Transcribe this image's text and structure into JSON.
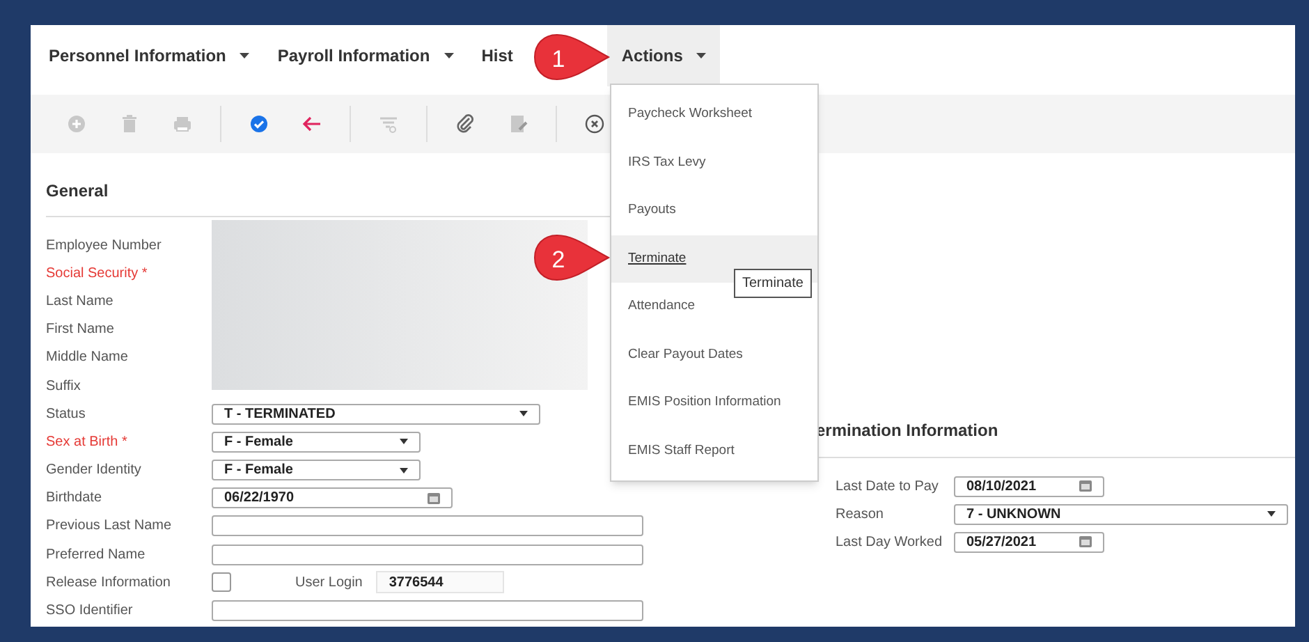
{
  "menus": [
    {
      "label": "Personnel Information",
      "caret": true,
      "selected": false
    },
    {
      "label": "Payroll Information",
      "caret": true,
      "selected": false
    },
    {
      "label": "Hist",
      "caret": false,
      "selected": false
    },
    {
      "label": "Actions",
      "caret": true,
      "selected": true
    }
  ],
  "toolbar": [
    [
      {
        "kind": "add",
        "disabled": true
      },
      {
        "kind": "delete",
        "disabled": true
      },
      {
        "kind": "print",
        "disabled": true
      }
    ],
    [
      {
        "kind": "save",
        "disabled": false
      },
      {
        "kind": "back",
        "disabled": false
      }
    ],
    [
      {
        "kind": "filter",
        "disabled": true
      }
    ],
    [
      {
        "kind": "attach",
        "disabled": false
      },
      {
        "kind": "edit",
        "disabled": true
      }
    ],
    [
      {
        "kind": "cancel",
        "disabled": false
      }
    ]
  ],
  "general": {
    "title": "General",
    "fields": [
      {
        "label": "Employee Number",
        "required": false,
        "kind": "redacted"
      },
      {
        "label": "Social Security *",
        "required": true,
        "kind": "redacted"
      },
      {
        "label": "Last Name",
        "required": false,
        "kind": "redacted"
      },
      {
        "label": "First Name",
        "required": false,
        "kind": "redacted"
      },
      {
        "label": "Middle Name",
        "required": false,
        "kind": "redacted"
      },
      {
        "label": "Suffix",
        "required": false,
        "kind": "redacted"
      },
      {
        "label": "Status",
        "required": false,
        "kind": "select_long",
        "value": "T - TERMINATED"
      },
      {
        "label": "Sex at Birth *",
        "required": true,
        "kind": "select",
        "value": "F - Female"
      },
      {
        "label": "Gender Identity",
        "required": false,
        "kind": "select",
        "value": "F - Female"
      },
      {
        "label": "Birthdate",
        "required": false,
        "kind": "date",
        "value": "06/22/1970"
      },
      {
        "label": "Previous Last Name",
        "required": false,
        "kind": "text"
      },
      {
        "label": "Preferred Name",
        "required": false,
        "kind": "text"
      },
      {
        "label": "Release Information",
        "required": false,
        "kind": "checkbox",
        "checked": false,
        "extra": {
          "label": "User Login",
          "value": "3776544"
        }
      },
      {
        "label": "SSO Identifier",
        "required": false,
        "kind": "text"
      }
    ]
  },
  "termination": {
    "title": "ermination Information",
    "fields": [
      {
        "label": "Last Date to Pay",
        "kind": "date",
        "value": "08/10/2021"
      },
      {
        "label": "Reason",
        "kind": "select_long",
        "value": "7 - UNKNOWN"
      },
      {
        "label": "Last Day Worked",
        "kind": "date",
        "value": "05/27/2021"
      }
    ]
  },
  "actions_menu": {
    "items": [
      {
        "label": "Paycheck Worksheet",
        "selected": false
      },
      {
        "label": "IRS Tax Levy",
        "selected": false
      },
      {
        "label": "Payouts",
        "selected": false
      },
      {
        "label": "Terminate",
        "selected": true
      },
      {
        "label": "Attendance",
        "selected": false
      },
      {
        "label": "Clear Payout Dates",
        "selected": false
      },
      {
        "label": "EMIS Position Information",
        "selected": false
      },
      {
        "label": "EMIS Staff Report",
        "selected": false
      }
    ],
    "tooltip": "Terminate"
  },
  "callouts": [
    "1",
    "2"
  ]
}
